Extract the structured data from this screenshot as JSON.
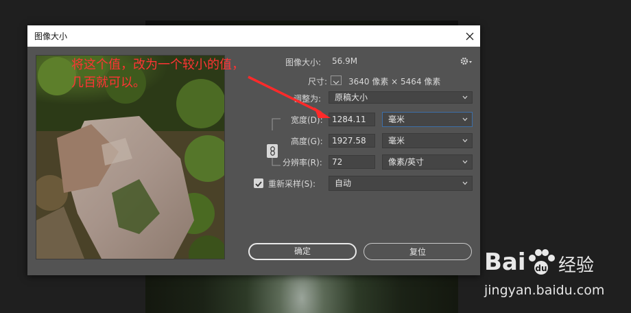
{
  "dialog": {
    "title": "图像大小",
    "image_size_label": "图像大小:",
    "image_size_value": "56.9M",
    "dimensions_label": "尺寸:",
    "dimensions_value": "3640 像素 × 5464 像素",
    "fit_label": "调整为:",
    "fit_value": "原稿大小",
    "width_label": "宽度(D):",
    "width_value": "1284.11",
    "width_unit": "毫米",
    "height_label": "高度(G):",
    "height_value": "1927.58",
    "height_unit": "毫米",
    "resolution_label": "分辨率(R):",
    "resolution_value": "72",
    "resolution_unit": "像素/英寸",
    "resample_label": "重新采样(S):",
    "resample_checked": true,
    "resample_value": "自动",
    "ok_label": "确定",
    "reset_label": "复位"
  },
  "annotation": {
    "line1": "将这个值，改为一个较小的值，",
    "line2": "几百就可以。",
    "color": "#ff3434"
  },
  "watermark": {
    "brand": "Bai",
    "brand_suffix": "经验",
    "url": "jingyan.baidu.com"
  },
  "icons": {
    "close": "close-icon",
    "gear": "gear-icon",
    "link": "link-icon",
    "chevron": "chevron-down-icon",
    "check": "check-icon"
  }
}
